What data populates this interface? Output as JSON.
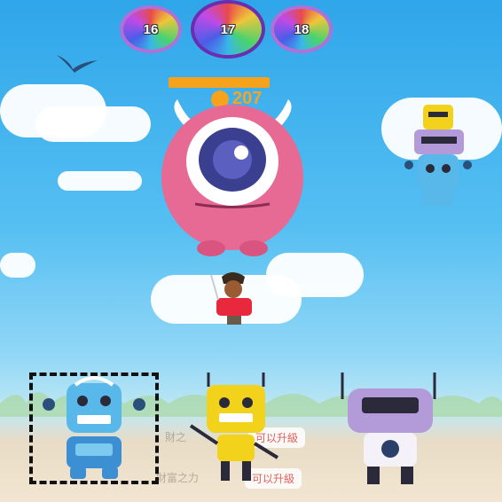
{
  "levels": {
    "prev": "16",
    "current": "17",
    "next": "18"
  },
  "boss": {
    "coin_value": "207",
    "health_fraction": 1.0
  },
  "robot_slots": [
    {
      "name": "blue robot",
      "selected": true
    },
    {
      "name": "yellow robot",
      "selected": false
    },
    {
      "name": "purple robot",
      "selected": false
    }
  ],
  "faded_labels": {
    "upgrade_1": "可以升級",
    "upgrade_2": "可以升級",
    "power_1": "財之",
    "power_2": "財富之力"
  },
  "colors": {
    "accent_orange": "#f6a21a",
    "boss_pink": "#e66a94",
    "selection_border": "#111111"
  }
}
